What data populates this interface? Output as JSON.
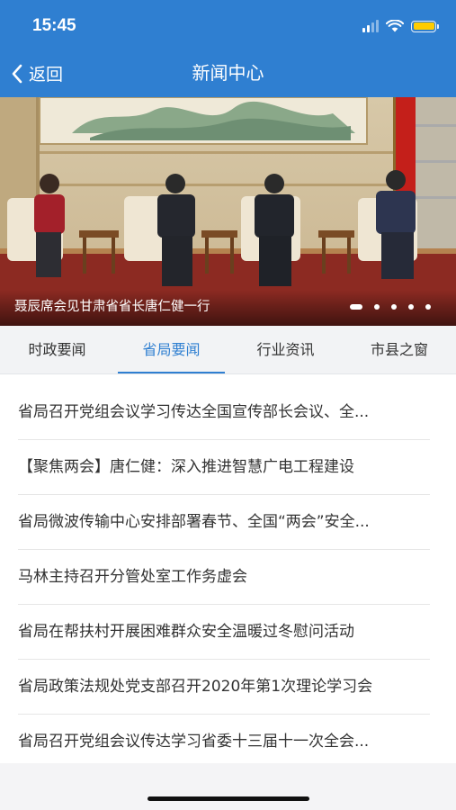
{
  "status_bar": {
    "time": "15:45"
  },
  "nav": {
    "back_label": "返回",
    "title": "新闻中心"
  },
  "banner": {
    "caption": "聂辰席会见甘肃省省长唐仁健一行",
    "slide_count": 5,
    "active_slide": 1
  },
  "tabs": [
    {
      "label": "时政要闻",
      "active": false
    },
    {
      "label": "省局要闻",
      "active": true
    },
    {
      "label": "行业资讯",
      "active": false
    },
    {
      "label": "市县之窗",
      "active": false
    }
  ],
  "news": [
    "省局召开党组会议学习传达全国宣传部长会议、全...",
    "【聚焦两会】唐仁健：深入推进智慧广电工程建设",
    "省局微波传输中心安排部署春节、全国“两会”安全...",
    "马林主持召开分管处室工作务虚会",
    "省局在帮扶村开展困难群众安全温暖过冬慰问活动",
    "省局政策法规处党支部召开2020年第1次理论学习会",
    "省局召开党组会议传达学习省委十三届十一次全会..."
  ],
  "colors": {
    "primary": "#2f7fd1",
    "tab_bg": "#f2f3f5"
  }
}
